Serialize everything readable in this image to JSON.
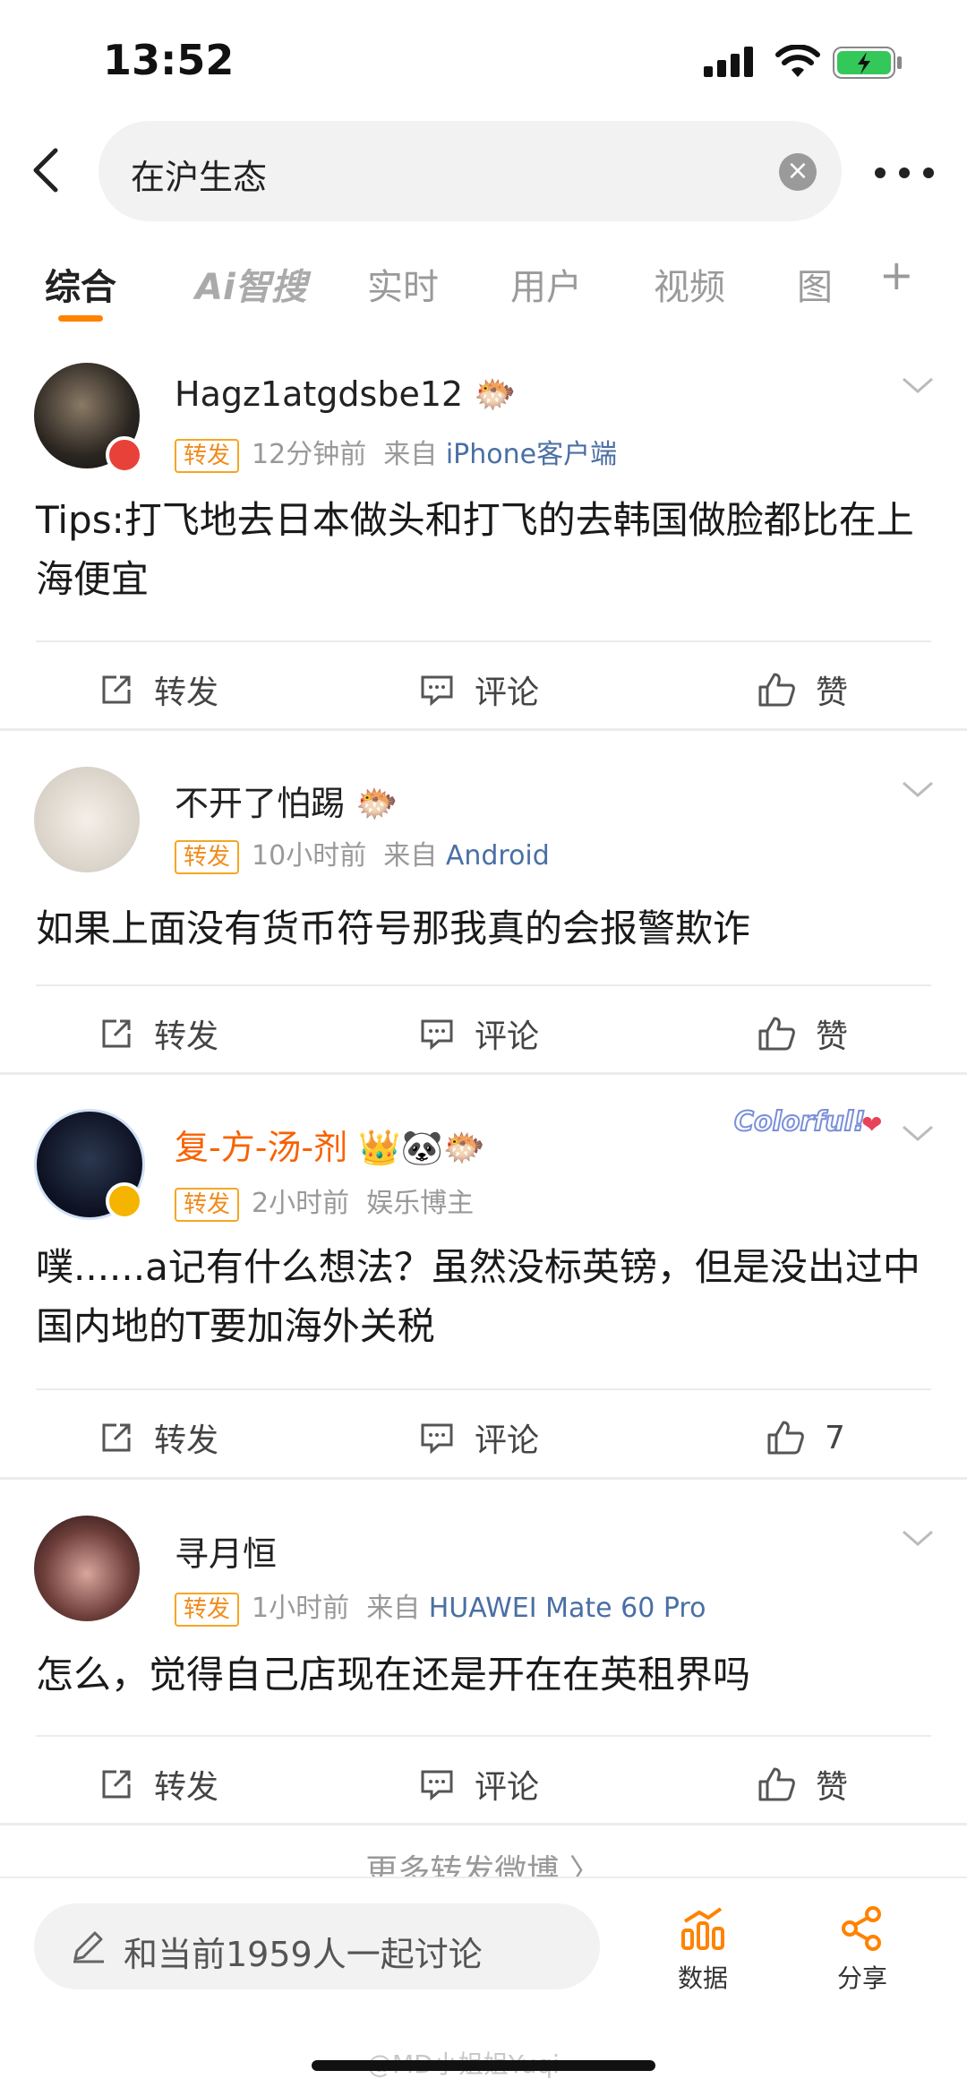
{
  "status_bar": {
    "time": "13:52"
  },
  "search": {
    "query": "在沪生态"
  },
  "tabs": [
    "综合",
    "Ai智搜",
    "实时",
    "用户",
    "视频",
    "图"
  ],
  "tab_add": "+",
  "posts": [
    {
      "username": "Hagz1atgdsbe12",
      "repost_tag": "转发",
      "time": "12分钟前",
      "from_label": "来自",
      "source": "iPhone客户端",
      "content": "Tips:打飞地去日本做头和打飞的去韩国做脸都比在上海便宜",
      "actions": {
        "repost": "转发",
        "comment": "评论",
        "like": "赞"
      }
    },
    {
      "username": "不开了怕踢",
      "repost_tag": "转发",
      "time": "10小时前",
      "from_label": "来自",
      "source": "Android",
      "content": "如果上面没有货币符号那我真的会报警欺诈",
      "actions": {
        "repost": "转发",
        "comment": "评论",
        "like": "赞"
      }
    },
    {
      "username": "复-方-汤-剂",
      "repost_tag": "转发",
      "time": "2小时前",
      "from_label": "",
      "source": "娱乐博主",
      "content": "噗......a记有什么想法？虽然没标英镑，但是没出过中国内地的T要加海外关税",
      "actions": {
        "repost": "转发",
        "comment": "评论",
        "like": "7"
      }
    },
    {
      "username": "寻月恒",
      "repost_tag": "转发",
      "time": "1小时前",
      "from_label": "来自",
      "source": "HUAWEI Mate 60 Pro",
      "content": "怎么，觉得自己店现在还是开在在英租界吗",
      "actions": {
        "repost": "转发",
        "comment": "评论",
        "like": "赞"
      }
    }
  ],
  "decoration_text": "Colorful!",
  "more_link": "更多转发微博 〉",
  "bottom": {
    "discuss": "和当前1959人一起讨论",
    "data": "数据",
    "share": "分享"
  },
  "watermark": "@MD小姐姐Yuqi",
  "colors": {
    "accent": "#ff8200",
    "source_link": "#4a6fa5",
    "vip_name": "#f86100"
  }
}
